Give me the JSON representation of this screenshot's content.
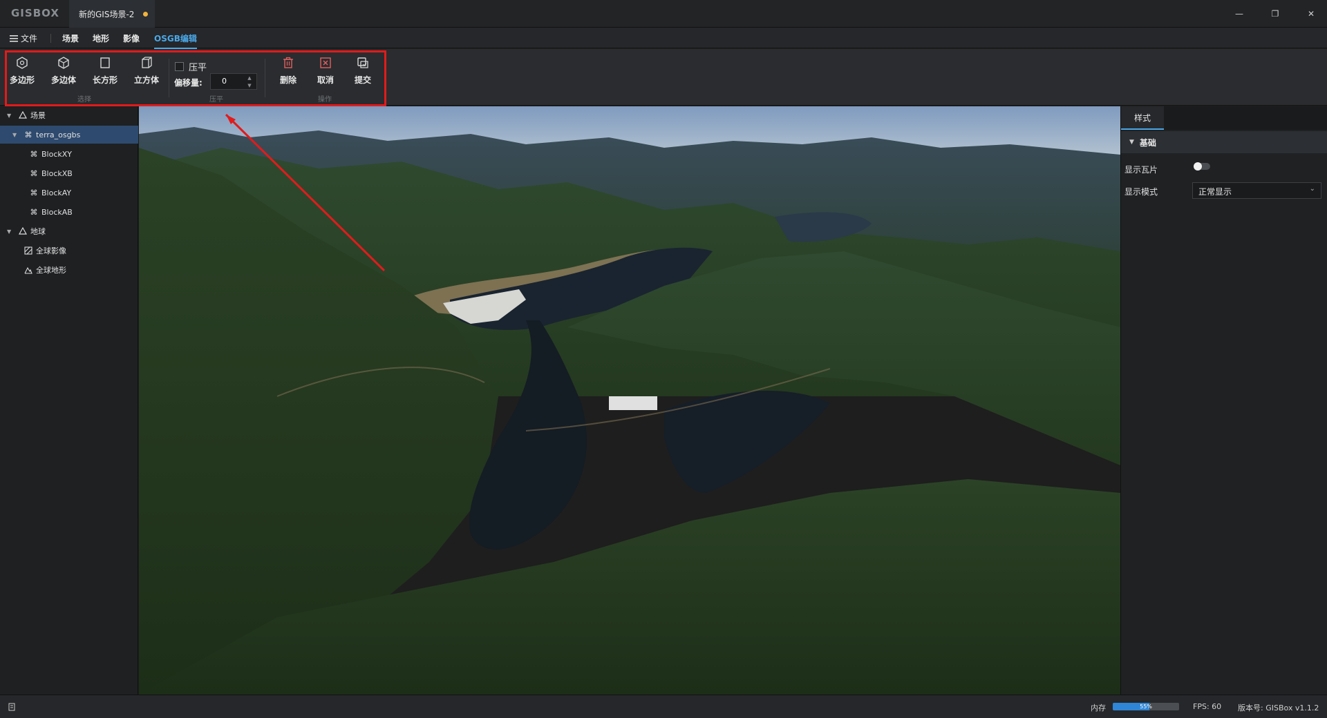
{
  "app": {
    "logo": "GISBOX",
    "doc_tab": "新的GIS场景-2"
  },
  "window": {
    "minimize": "—",
    "restore": "❐",
    "close": "✕"
  },
  "menu": {
    "file": "文件",
    "items": [
      "场景",
      "地形",
      "影像",
      "OSGB编辑"
    ],
    "active_index": 3
  },
  "ribbon": {
    "select_group": {
      "label": "选择",
      "buttons": [
        "多边形",
        "多边体",
        "长方形",
        "立方体"
      ]
    },
    "flatten_group": {
      "label": "压平",
      "checkbox_label": "压平",
      "checked": false,
      "offset_label": "偏移量:",
      "offset_value": "0"
    },
    "ops_group": {
      "label": "操作",
      "buttons": [
        "删除",
        "取消",
        "提交"
      ]
    }
  },
  "tree": {
    "scene_label": "场景",
    "model_label": "terra_osgbs",
    "blocks": [
      "BlockXY",
      "BlockXB",
      "BlockAY",
      "BlockAB"
    ],
    "earth_label": "地球",
    "earth_children": [
      "全球影像",
      "全球地形"
    ]
  },
  "right_panel": {
    "tab": "样式",
    "section": "基础",
    "show_tiles_label": "显示瓦片",
    "show_tiles_on": false,
    "display_mode_label": "显示模式",
    "display_mode_value": "正常显示"
  },
  "status": {
    "memory_label": "内存",
    "memory_percent": 55,
    "memory_text": "55%",
    "fps": "FPS: 60",
    "version": "版本号: GISBox v1.1.2"
  },
  "colors": {
    "accent": "#4aa8e8",
    "highlight": "#e21b1b",
    "dirty_dot": "#f0b43c"
  }
}
